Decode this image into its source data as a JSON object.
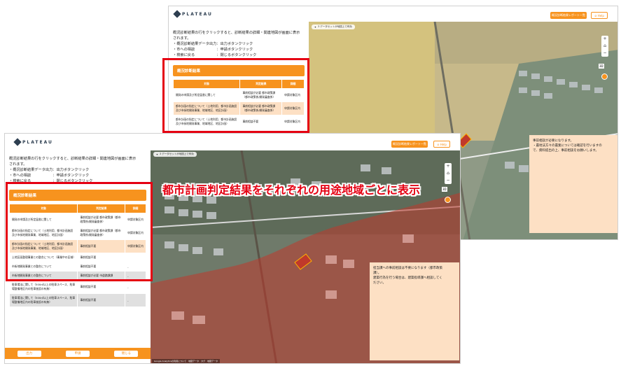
{
  "app": {
    "logo_text": "PLATEAU",
    "result_list_button": "概況診断結果レポート一覧",
    "help_button": "Help"
  },
  "instructions": {
    "line1": "概況診断結果の行をクリックすると、診断結果の詳細・関連地図が画面に表示",
    "line2": "されます。",
    "items": [
      "・概況診断結果データ出力：出力ボタンクリック",
      "・市への相談　　　　　　：申請ボタンクリック",
      "・検索に戻る　　　　　　：閉じるボタンクリック"
    ]
  },
  "results": {
    "title": "概況診断結果",
    "columns": [
      "対象",
      "判定結果",
      "詳細"
    ],
    "rows": [
      {
        "target": "開発の申請及び所定届書に関して",
        "result": "事前相談が必要 都市政策課（都市政策係/開発審査係）",
        "detail": "申請対象区内"
      },
      {
        "target": "都市計画の指定について（土地利用、都市計画施設及び市街地開発事業、地域地区、地区計画）",
        "result": "事前相談が必要 都市政策課（都市政策係/開発審査係）",
        "detail": "申請対象区内"
      },
      {
        "target": "都市計画の指定について（土地利用、都市計画施設及び市街地開発事業、地域地区、地区計画）",
        "result": "事前相談不要",
        "detail": "申請対象区内"
      },
      {
        "target": "土地区画整理事業との整合について（事業中の区域）",
        "result": "事前相談不要",
        "detail": ""
      },
      {
        "target": "市街地開発事業との整合について",
        "result": "事前相談不要",
        "detail": "-"
      },
      {
        "target": "市街地開発事業との整合について",
        "result": "事前相談が必要 市道路課課",
        "detail": "-"
      },
      {
        "target": "駐車場法に関して（500㎡以上の駐車スペース、駐車場整備地区内の駐車施設の有無）",
        "result": "事前相談不要",
        "detail": "-"
      },
      {
        "target": "駐車場法に関して（500㎡以上の駐車スペース、駐車場整備地区内の駐車施設の有無）",
        "result": "事前相談不要",
        "detail": "-"
      }
    ]
  },
  "map": {
    "notice": "3 データセットが地図上で有効",
    "attribution_back": "Google Analyticsの利用について　地図データ　タグ　地図データ",
    "attribution_front": "Google Analyticsの利用について　地図データ　タグ　地図データ",
    "view_mode_label": "3D"
  },
  "info_back": {
    "lines": [
      "事前相談が必要になります。",
      "・農地法方々の農業については確認を行いますの",
      "で、資料提出の上、事前相談をお願いします。"
    ]
  },
  "info_front": {
    "lines": [
      "担当課への事前相談は不要になります（都市政策",
      "課）。",
      "建築行為を行う場合は、建築指導課へ相談してく",
      "ださい。"
    ]
  },
  "bottom_buttons": {
    "output": "出力",
    "apply": "申請",
    "close": "閉じる"
  },
  "headline": "都市計画判定結果をそれぞれの用途地域ごとに表示",
  "colors": {
    "accent": "#f7931e",
    "highlight_red": "#e50012",
    "peach": "#fde0c4"
  }
}
